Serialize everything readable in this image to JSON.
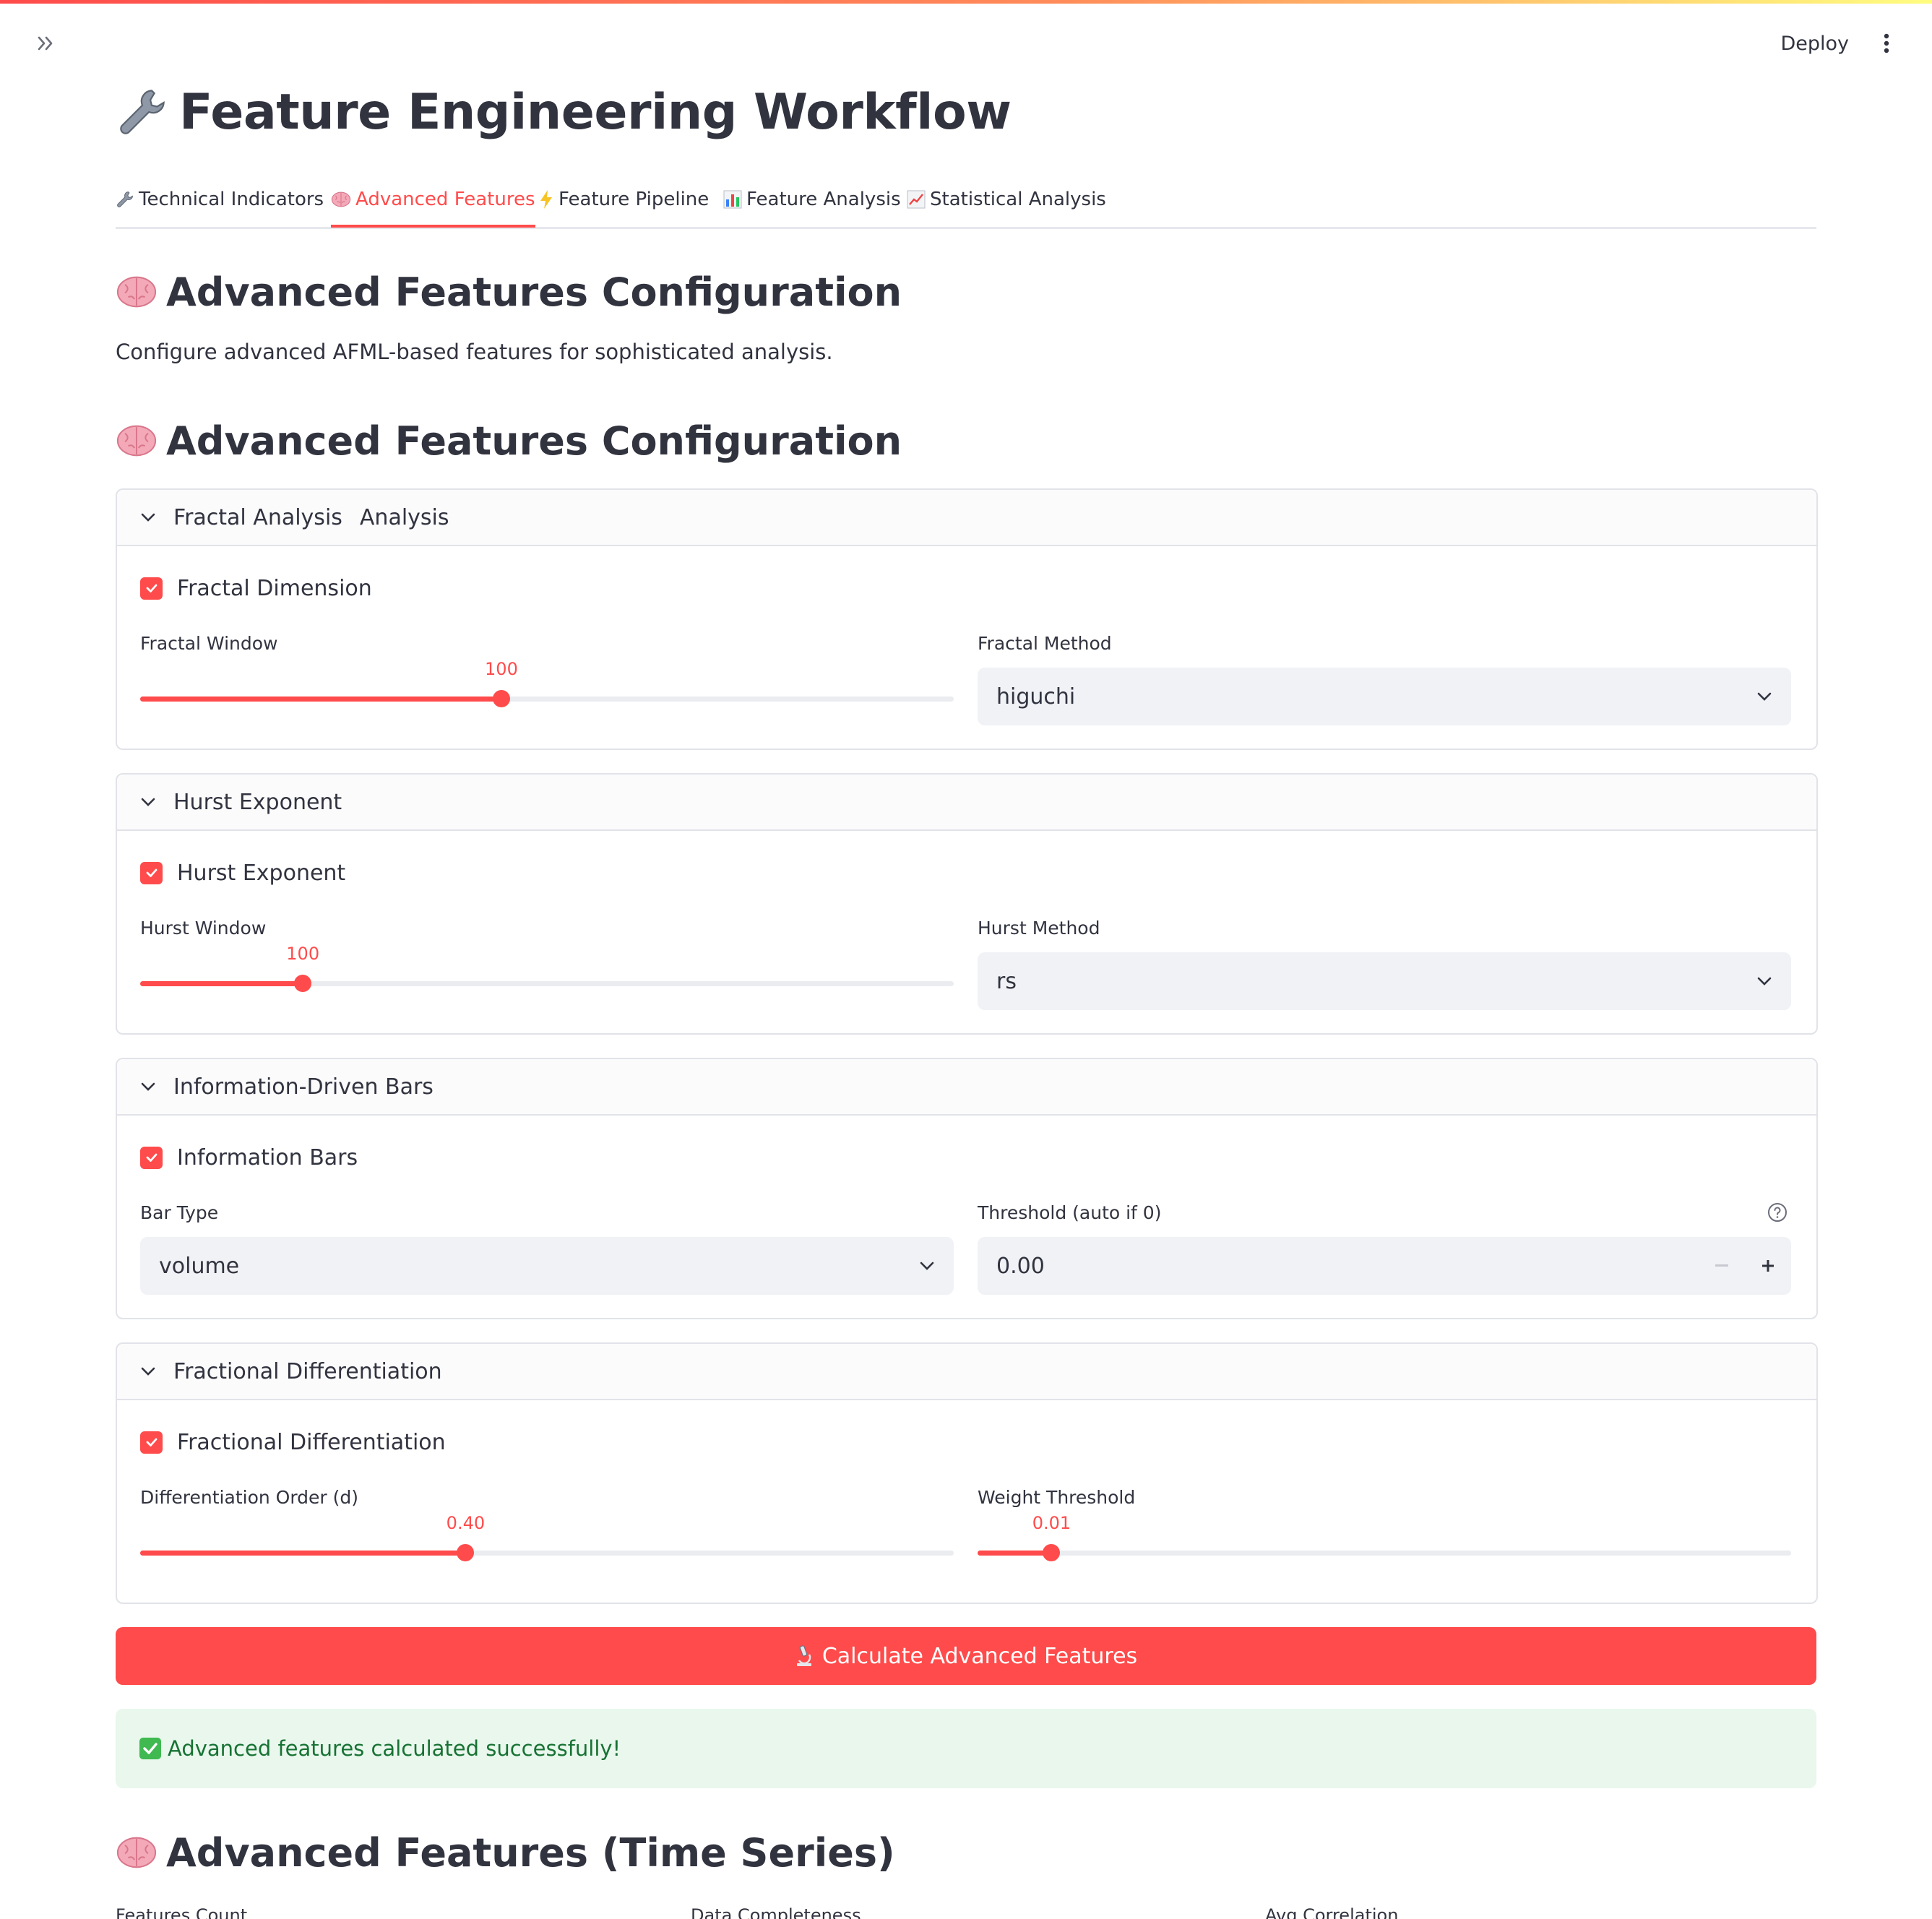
{
  "app": {
    "deploy_label": "Deploy",
    "title_icon": "wrench-icon",
    "title": "Feature Engineering Workflow",
    "accent_color": "#ff4b4b"
  },
  "tabs": [
    {
      "icon": "wrench-icon",
      "label": "Technical Indicators",
      "active": false
    },
    {
      "icon": "brain-icon",
      "label": "Advanced Features",
      "active": true
    },
    {
      "icon": "lightning-icon",
      "label": "Feature Pipeline",
      "active": false
    },
    {
      "icon": "bar-chart-icon",
      "label": "Feature Analysis",
      "active": false
    },
    {
      "icon": "chart-up-icon",
      "label": "Statistical Analysis",
      "active": false
    }
  ],
  "header": {
    "heading": "Advanced Features Configuration",
    "caption": "Configure advanced AFML-based features for sophisticated analysis."
  },
  "config": {
    "heading": "Advanced Features Configuration",
    "fractal": {
      "title": "Fractal Analysis",
      "checkbox_label": "Fractal Dimension",
      "checked": true,
      "window_label": "Fractal Window",
      "window_value": "100",
      "window_fill": 0.444,
      "method_label": "Fractal Method",
      "method_value": "higuchi"
    },
    "hurst": {
      "title": "Hurst Exponent",
      "checkbox_label": "Hurst Exponent",
      "checked": true,
      "window_label": "Hurst Window",
      "window_value": "100",
      "window_fill": 0.2,
      "method_label": "Hurst Method",
      "method_value": "rs"
    },
    "info_bars": {
      "title": "Information-Driven Bars",
      "checkbox_label": "Information Bars",
      "checked": true,
      "bar_type_label": "Bar Type",
      "bar_type_value": "volume",
      "threshold_label": "Threshold (auto if 0)",
      "threshold_value": "0.00"
    },
    "frac_diff": {
      "title": "Fractional Differentiation",
      "checkbox_label": "Fractional Differentiation",
      "checked": true,
      "order_label": "Differentiation Order (d)",
      "order_value": "0.40",
      "order_fill": 0.4,
      "weight_label": "Weight Threshold",
      "weight_value": "0.01",
      "weight_fill": 0.091
    }
  },
  "actions": {
    "calculate_icon": "microscope-icon",
    "calculate_label": "Calculate Advanced Features",
    "success_icon": "check-mark-icon",
    "success_message": "Advanced features calculated successfully!"
  },
  "results": {
    "heading": "Advanced Features (Time Series)",
    "metrics": [
      {
        "label": "Features Count"
      },
      {
        "label": "Data Completeness"
      },
      {
        "label": "Avg Correlation"
      }
    ]
  }
}
